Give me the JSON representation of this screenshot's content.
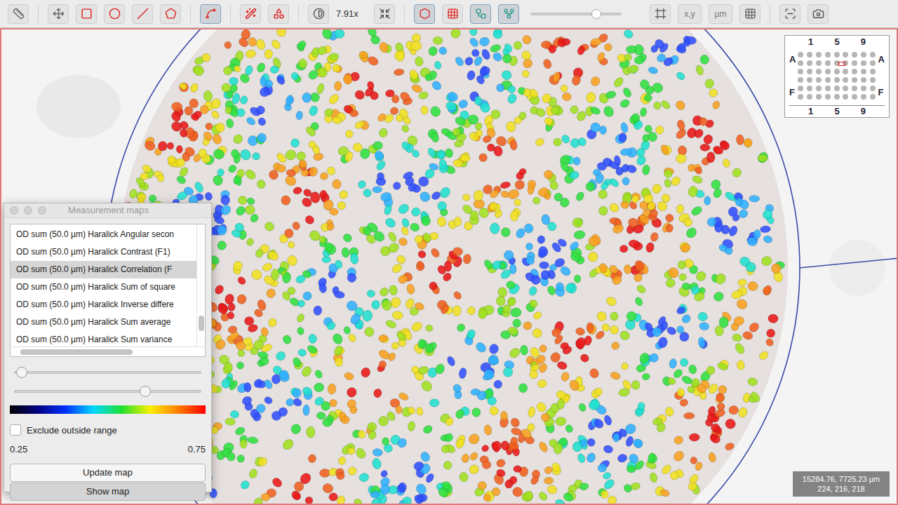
{
  "toolbar": {
    "tools": [
      {
        "selected": false
      },
      {
        "selected": false
      },
      {
        "selected": false
      },
      {
        "selected": false
      },
      {
        "selected": false
      },
      {
        "selected": false
      },
      {
        "selected": true
      },
      {
        "selected": false
      },
      {
        "selected": false
      }
    ],
    "contrast": {
      "selected": false
    },
    "zoom": "7.91x",
    "fit": {
      "selected": false
    },
    "toggles": [
      {
        "selected": true
      },
      {
        "selected": false
      },
      {
        "selected": true
      },
      {
        "selected": true
      }
    ],
    "opacity_slider": {
      "level": 0.72
    },
    "view_buttons": [
      {
        "label": "",
        "selected": false
      },
      {
        "label": "x,y",
        "selected": false
      },
      {
        "label": "µm",
        "selected": false
      },
      {
        "label": "",
        "selected": false
      }
    ],
    "extra_buttons": [
      {
        "selected": false
      },
      {
        "selected": false
      }
    ]
  },
  "overview": {
    "top_labels": [
      "1",
      "5",
      "9"
    ],
    "bottom_labels": [
      "1",
      "5",
      "9"
    ],
    "left_labels": [
      "A",
      "F"
    ],
    "right_labels": [
      "A",
      "F"
    ]
  },
  "cursor_info": {
    "position": "15284.76, 7725.23 µm",
    "rgb": "224, 216, 218"
  },
  "measurement_maps": {
    "title": "Measurement maps",
    "items": [
      {
        "label": "OD sum (50.0 µm) Haralick Angular secon",
        "selected": false
      },
      {
        "label": "OD sum (50.0 µm) Haralick Contrast (F1)",
        "selected": false
      },
      {
        "label": "OD sum (50.0 µm) Haralick Correlation (F",
        "selected": true
      },
      {
        "label": "OD sum (50.0 µm) Haralick Sum of square",
        "selected": false
      },
      {
        "label": "OD sum (50.0 µm) Haralick Inverse differe",
        "selected": false
      },
      {
        "label": "OD sum (50.0 µm) Haralick Sum average",
        "selected": false
      },
      {
        "label": "OD sum (50.0 µm) Haralick Sum variance",
        "selected": false
      }
    ],
    "min_slider": {
      "level": 0.04
    },
    "max_slider": {
      "level": 0.7
    },
    "exclude_outside_range": {
      "label": "Exclude outside range",
      "checked": false
    },
    "range_min": "0.25",
    "range_max": "0.75",
    "buttons": [
      {
        "label": "Update map",
        "selected": false
      },
      {
        "label": "Show map",
        "selected": true
      }
    ]
  }
}
